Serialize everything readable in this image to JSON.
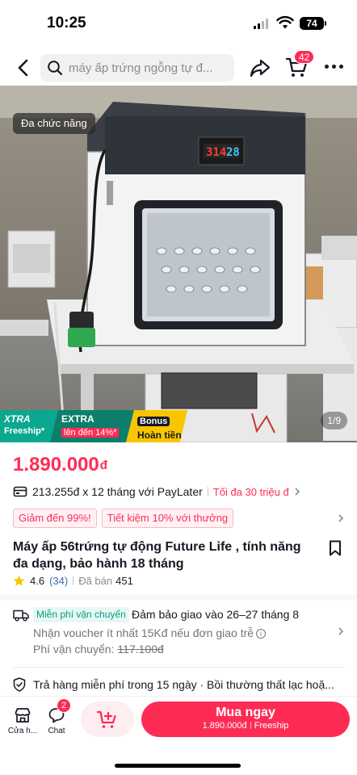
{
  "status": {
    "time": "10:25",
    "battery": "74"
  },
  "nav": {
    "search_placeholder": "máy ấp trứng ngỗng tự đ...",
    "cart_count": "42"
  },
  "hero": {
    "tag": "Đa chức năng",
    "counter": "1/9",
    "display_left": "314",
    "display_right": "28",
    "promo": {
      "xtra_title": "XTRA",
      "xtra_sub": "Freeship*",
      "extra_title": "EXTRA",
      "extra_sub": "lên đến 14%*",
      "bonus_title": "Bonus",
      "bonus_sub": "Hoàn tiền"
    }
  },
  "product": {
    "price": "1.890.000",
    "currency": "đ",
    "paylater_text": "213.255đ x 12 tháng với PayLater",
    "paylater_max": "Tối đa 30 triệu đ",
    "coupons": [
      "Giảm đến 99%!",
      "Tiết kiệm 10% với thưởng"
    ],
    "title": "Máy ấp 56trứng tự động Future Life , tính năng đa dạng, bảo hành 18 tháng",
    "rating": "4.6",
    "review_count": "(34)",
    "sold_label": "Đã bán",
    "sold": "451"
  },
  "shipping": {
    "badge": "Miễn phí vận chuyển",
    "date": "Đảm bảo giao vào 26–27 tháng 8",
    "voucher": "Nhận voucher ít nhất 15Kđ nếu đơn giao trễ",
    "fee_label": "Phí vận chuyển:",
    "fee_old": "117.100đ"
  },
  "returns": {
    "text": "Trả hàng miễn phí trong 15 ngày · Bồi thường thất lạc hoặ..."
  },
  "bottom": {
    "shop_label": "Cửa h...",
    "chat_label": "Chat",
    "chat_badge": "2",
    "buy_label": "Mua ngay",
    "buy_price": "1.890.000đ",
    "buy_ship": "Freeship"
  },
  "colors": {
    "accent": "#fe2c55",
    "teal": "#0aa88e",
    "yellow": "#f7c600"
  }
}
